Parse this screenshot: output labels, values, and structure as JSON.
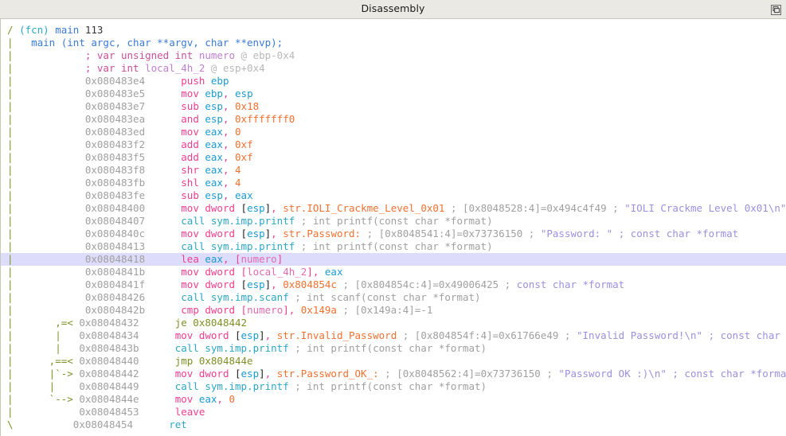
{
  "window": {
    "title": "Disassembly",
    "restore_button_icon": "restore-window-icon"
  },
  "disassembly": {
    "lines": [
      {
        "id": "fcn-header",
        "highlight": false,
        "tokens": [
          {
            "c": "t-flow",
            "t": "/ "
          },
          {
            "c": "t-fcn",
            "t": "(fcn) "
          },
          {
            "c": "t-fname",
            "t": "main "
          },
          {
            "c": "t-num",
            "t": "113"
          }
        ]
      },
      {
        "id": "fcn-prototype",
        "highlight": false,
        "tokens": [
          {
            "c": "t-flow",
            "t": "|   "
          },
          {
            "c": "t-proto",
            "t": "main (int argc, char **argv, char **envp);"
          }
        ]
      },
      {
        "id": "var-numero",
        "highlight": false,
        "tokens": [
          {
            "c": "t-flow",
            "t": "|            "
          },
          {
            "c": "t-vkw",
            "t": "; var unsigned int "
          },
          {
            "c": "t-vname",
            "t": "numero "
          },
          {
            "c": "t-vloc",
            "t": "@ ebp-0x4"
          }
        ]
      },
      {
        "id": "var-local-4h-2",
        "highlight": false,
        "tokens": [
          {
            "c": "t-flow",
            "t": "|            "
          },
          {
            "c": "t-vkw",
            "t": "; var int "
          },
          {
            "c": "t-vname",
            "t": "local_4h_2 "
          },
          {
            "c": "t-vloc",
            "t": "@ esp+0x4"
          }
        ]
      },
      {
        "id": "insn-080483e4",
        "highlight": false,
        "tokens": [
          {
            "c": "t-flow",
            "t": "|            "
          },
          {
            "c": "t-addr",
            "t": "0x080483e4      "
          },
          {
            "c": "t-mov",
            "t": "push "
          },
          {
            "c": "t-reg",
            "t": "ebp"
          }
        ]
      },
      {
        "id": "insn-080483e5",
        "highlight": false,
        "tokens": [
          {
            "c": "t-flow",
            "t": "|            "
          },
          {
            "c": "t-addr",
            "t": "0x080483e5      "
          },
          {
            "c": "t-mov",
            "t": "mov "
          },
          {
            "c": "t-reg",
            "t": "ebp"
          },
          {
            "c": "t-mov",
            "t": ", "
          },
          {
            "c": "t-reg",
            "t": "esp"
          }
        ]
      },
      {
        "id": "insn-080483e7",
        "highlight": false,
        "tokens": [
          {
            "c": "t-flow",
            "t": "|            "
          },
          {
            "c": "t-addr",
            "t": "0x080483e7      "
          },
          {
            "c": "t-mov",
            "t": "sub "
          },
          {
            "c": "t-reg",
            "t": "esp"
          },
          {
            "c": "t-mov",
            "t": ", "
          },
          {
            "c": "t-imm",
            "t": "0x18"
          }
        ]
      },
      {
        "id": "insn-080483ea",
        "highlight": false,
        "tokens": [
          {
            "c": "t-flow",
            "t": "|            "
          },
          {
            "c": "t-addr",
            "t": "0x080483ea      "
          },
          {
            "c": "t-mov",
            "t": "and "
          },
          {
            "c": "t-reg",
            "t": "esp"
          },
          {
            "c": "t-mov",
            "t": ", "
          },
          {
            "c": "t-imm",
            "t": "0xfffffff0"
          }
        ]
      },
      {
        "id": "insn-080483ed",
        "highlight": false,
        "tokens": [
          {
            "c": "t-flow",
            "t": "|            "
          },
          {
            "c": "t-addr",
            "t": "0x080483ed      "
          },
          {
            "c": "t-mov",
            "t": "mov "
          },
          {
            "c": "t-reg",
            "t": "eax"
          },
          {
            "c": "t-mov",
            "t": ", "
          },
          {
            "c": "t-imm",
            "t": "0"
          }
        ]
      },
      {
        "id": "insn-080483f2",
        "highlight": false,
        "tokens": [
          {
            "c": "t-flow",
            "t": "|            "
          },
          {
            "c": "t-addr",
            "t": "0x080483f2      "
          },
          {
            "c": "t-mov",
            "t": "add "
          },
          {
            "c": "t-reg",
            "t": "eax"
          },
          {
            "c": "t-mov",
            "t": ", "
          },
          {
            "c": "t-imm",
            "t": "0xf"
          }
        ]
      },
      {
        "id": "insn-080483f5",
        "highlight": false,
        "tokens": [
          {
            "c": "t-flow",
            "t": "|            "
          },
          {
            "c": "t-addr",
            "t": "0x080483f5      "
          },
          {
            "c": "t-mov",
            "t": "add "
          },
          {
            "c": "t-reg",
            "t": "eax"
          },
          {
            "c": "t-mov",
            "t": ", "
          },
          {
            "c": "t-imm",
            "t": "0xf"
          }
        ]
      },
      {
        "id": "insn-080483f8",
        "highlight": false,
        "tokens": [
          {
            "c": "t-flow",
            "t": "|            "
          },
          {
            "c": "t-addr",
            "t": "0x080483f8      "
          },
          {
            "c": "t-mov",
            "t": "shr "
          },
          {
            "c": "t-reg",
            "t": "eax"
          },
          {
            "c": "t-mov",
            "t": ", "
          },
          {
            "c": "t-imm",
            "t": "4"
          }
        ]
      },
      {
        "id": "insn-080483fb",
        "highlight": false,
        "tokens": [
          {
            "c": "t-flow",
            "t": "|            "
          },
          {
            "c": "t-addr",
            "t": "0x080483fb      "
          },
          {
            "c": "t-mov",
            "t": "shl "
          },
          {
            "c": "t-reg",
            "t": "eax"
          },
          {
            "c": "t-mov",
            "t": ", "
          },
          {
            "c": "t-imm",
            "t": "4"
          }
        ]
      },
      {
        "id": "insn-080483fe",
        "highlight": false,
        "tokens": [
          {
            "c": "t-flow",
            "t": "|            "
          },
          {
            "c": "t-addr",
            "t": "0x080483fe      "
          },
          {
            "c": "t-mov",
            "t": "sub "
          },
          {
            "c": "t-reg",
            "t": "esp"
          },
          {
            "c": "t-mov",
            "t": ", "
          },
          {
            "c": "t-reg",
            "t": "eax"
          }
        ]
      },
      {
        "id": "insn-08048400",
        "highlight": false,
        "tokens": [
          {
            "c": "t-flow",
            "t": "|            "
          },
          {
            "c": "t-addr",
            "t": "0x08048400      "
          },
          {
            "c": "t-mov",
            "t": "mov dword "
          },
          {
            "c": "t-regb",
            "t": "["
          },
          {
            "c": "t-reg",
            "t": "esp"
          },
          {
            "c": "t-regb",
            "t": "]"
          },
          {
            "c": "t-mov",
            "t": ", "
          },
          {
            "c": "t-str",
            "t": "str.IOLI_Crackme_Level_0x01"
          },
          {
            "c": "t-cmt",
            "t": " ; [0x8048528:4]=0x494c4f49 ; "
          },
          {
            "c": "t-cmtstr",
            "t": "\"IOLI Crackme Level 0x01\\n\""
          }
        ]
      },
      {
        "id": "insn-08048407",
        "highlight": false,
        "tokens": [
          {
            "c": "t-flow",
            "t": "|            "
          },
          {
            "c": "t-addr",
            "t": "0x08048407      "
          },
          {
            "c": "t-call",
            "t": "call sym.imp.printf"
          },
          {
            "c": "t-cmt",
            "t": " ; int printf(const char *format)"
          }
        ]
      },
      {
        "id": "insn-0804840c",
        "highlight": false,
        "tokens": [
          {
            "c": "t-flow",
            "t": "|            "
          },
          {
            "c": "t-addr",
            "t": "0x0804840c      "
          },
          {
            "c": "t-mov",
            "t": "mov dword "
          },
          {
            "c": "t-regb",
            "t": "["
          },
          {
            "c": "t-reg",
            "t": "esp"
          },
          {
            "c": "t-regb",
            "t": "]"
          },
          {
            "c": "t-mov",
            "t": ", "
          },
          {
            "c": "t-str",
            "t": "str.Password:"
          },
          {
            "c": "t-cmt",
            "t": " ; [0x8048541:4]=0x73736150 ; "
          },
          {
            "c": "t-cmtstr",
            "t": "\"Password: \" ; const char *format"
          }
        ]
      },
      {
        "id": "insn-08048413",
        "highlight": false,
        "tokens": [
          {
            "c": "t-flow",
            "t": "|            "
          },
          {
            "c": "t-addr",
            "t": "0x08048413      "
          },
          {
            "c": "t-call",
            "t": "call sym.imp.printf"
          },
          {
            "c": "t-cmt",
            "t": " ; int printf(const char *format)"
          }
        ]
      },
      {
        "id": "insn-08048418",
        "highlight": true,
        "tokens": [
          {
            "c": "t-flow",
            "t": "|            "
          },
          {
            "c": "t-addr",
            "t": "0x08048418      "
          },
          {
            "c": "t-mov",
            "t": "lea "
          },
          {
            "c": "t-reg",
            "t": "eax"
          },
          {
            "c": "t-mov",
            "t": ", ["
          },
          {
            "c": "t-var",
            "t": "numero"
          },
          {
            "c": "t-mov",
            "t": "]"
          }
        ]
      },
      {
        "id": "insn-0804841b",
        "highlight": false,
        "tokens": [
          {
            "c": "t-flow",
            "t": "|            "
          },
          {
            "c": "t-addr",
            "t": "0x0804841b      "
          },
          {
            "c": "t-mov",
            "t": "mov dword ["
          },
          {
            "c": "t-var",
            "t": "local_4h_2"
          },
          {
            "c": "t-mov",
            "t": "], "
          },
          {
            "c": "t-reg",
            "t": "eax"
          }
        ]
      },
      {
        "id": "insn-0804841f",
        "highlight": false,
        "tokens": [
          {
            "c": "t-flow",
            "t": "|            "
          },
          {
            "c": "t-addr",
            "t": "0x0804841f      "
          },
          {
            "c": "t-mov",
            "t": "mov dword "
          },
          {
            "c": "t-regb",
            "t": "["
          },
          {
            "c": "t-reg",
            "t": "esp"
          },
          {
            "c": "t-regb",
            "t": "]"
          },
          {
            "c": "t-mov",
            "t": ", "
          },
          {
            "c": "t-imm",
            "t": "0x804854c"
          },
          {
            "c": "t-cmt",
            "t": " ; [0x804854c:4]=0x49006425 ; "
          },
          {
            "c": "t-cmtstr",
            "t": "const char *format"
          }
        ]
      },
      {
        "id": "insn-08048426",
        "highlight": false,
        "tokens": [
          {
            "c": "t-flow",
            "t": "|            "
          },
          {
            "c": "t-addr",
            "t": "0x08048426      "
          },
          {
            "c": "t-call",
            "t": "call sym.imp.scanf"
          },
          {
            "c": "t-cmt",
            "t": " ; int scanf(const char *format)"
          }
        ]
      },
      {
        "id": "insn-0804842b",
        "highlight": false,
        "tokens": [
          {
            "c": "t-flow",
            "t": "|            "
          },
          {
            "c": "t-addr",
            "t": "0x0804842b      "
          },
          {
            "c": "t-mov",
            "t": "cmp dword ["
          },
          {
            "c": "t-var",
            "t": "numero"
          },
          {
            "c": "t-mov",
            "t": "], "
          },
          {
            "c": "t-imm",
            "t": "0x149a"
          },
          {
            "c": "t-cmt",
            "t": " ; [0x149a:4]=-1"
          }
        ]
      },
      {
        "id": "insn-08048432",
        "highlight": false,
        "tokens": [
          {
            "c": "t-flow",
            "t": "|       ,=< "
          },
          {
            "c": "t-addr",
            "t": "0x08048432      "
          },
          {
            "c": "t-jmp",
            "t": "je 0x8048442"
          }
        ]
      },
      {
        "id": "insn-08048434",
        "highlight": false,
        "tokens": [
          {
            "c": "t-flow",
            "t": "|       |   "
          },
          {
            "c": "t-addr",
            "t": "0x08048434      "
          },
          {
            "c": "t-mov",
            "t": "mov dword "
          },
          {
            "c": "t-regb",
            "t": "["
          },
          {
            "c": "t-reg",
            "t": "esp"
          },
          {
            "c": "t-regb",
            "t": "]"
          },
          {
            "c": "t-mov",
            "t": ", "
          },
          {
            "c": "t-str",
            "t": "str.Invalid_Password"
          },
          {
            "c": "t-cmt",
            "t": " ; [0x804854f:4]=0x61766e49 ; "
          },
          {
            "c": "t-cmtstr",
            "t": "\"Invalid Password!\\n\" ; const char *format"
          }
        ]
      },
      {
        "id": "insn-0804843b",
        "highlight": false,
        "tokens": [
          {
            "c": "t-flow",
            "t": "|       |   "
          },
          {
            "c": "t-addr",
            "t": "0x0804843b      "
          },
          {
            "c": "t-call",
            "t": "call sym.imp.printf"
          },
          {
            "c": "t-cmt",
            "t": " ; int printf(const char *format)"
          }
        ]
      },
      {
        "id": "insn-08048440",
        "highlight": false,
        "tokens": [
          {
            "c": "t-flow",
            "t": "|      ,==< "
          },
          {
            "c": "t-addr",
            "t": "0x08048440      "
          },
          {
            "c": "t-jmp",
            "t": "jmp 0x804844e"
          }
        ]
      },
      {
        "id": "insn-08048442",
        "highlight": false,
        "tokens": [
          {
            "c": "t-flow",
            "t": "|      |`-> "
          },
          {
            "c": "t-addr",
            "t": "0x08048442      "
          },
          {
            "c": "t-mov",
            "t": "mov dword "
          },
          {
            "c": "t-regb",
            "t": "["
          },
          {
            "c": "t-reg",
            "t": "esp"
          },
          {
            "c": "t-regb",
            "t": "]"
          },
          {
            "c": "t-mov",
            "t": ", "
          },
          {
            "c": "t-str",
            "t": "str.Password_OK_:"
          },
          {
            "c": "t-cmt",
            "t": " ; [0x8048562:4]=0x73736150 ; "
          },
          {
            "c": "t-cmtstr",
            "t": "\"Password OK :)\\n\" ; const char *format"
          }
        ]
      },
      {
        "id": "insn-08048449",
        "highlight": false,
        "tokens": [
          {
            "c": "t-flow",
            "t": "|      |    "
          },
          {
            "c": "t-addr",
            "t": "0x08048449      "
          },
          {
            "c": "t-call",
            "t": "call sym.imp.printf"
          },
          {
            "c": "t-cmt",
            "t": " ; int printf(const char *format)"
          }
        ]
      },
      {
        "id": "insn-0804844e",
        "highlight": false,
        "tokens": [
          {
            "c": "t-flow",
            "t": "|      `--> "
          },
          {
            "c": "t-addr",
            "t": "0x0804844e      "
          },
          {
            "c": "t-mov",
            "t": "mov "
          },
          {
            "c": "t-reg",
            "t": "eax"
          },
          {
            "c": "t-mov",
            "t": ", "
          },
          {
            "c": "t-imm",
            "t": "0"
          }
        ]
      },
      {
        "id": "insn-08048453",
        "highlight": false,
        "tokens": [
          {
            "c": "t-flow",
            "t": "|           "
          },
          {
            "c": "t-addr",
            "t": "0x08048453      "
          },
          {
            "c": "t-mov",
            "t": "leave"
          }
        ]
      },
      {
        "id": "insn-08048454",
        "highlight": false,
        "tokens": [
          {
            "c": "t-flow",
            "t": "\\          "
          },
          {
            "c": "t-addr",
            "t": "0x08048454      "
          },
          {
            "c": "t-call",
            "t": "ret"
          }
        ]
      }
    ]
  }
}
